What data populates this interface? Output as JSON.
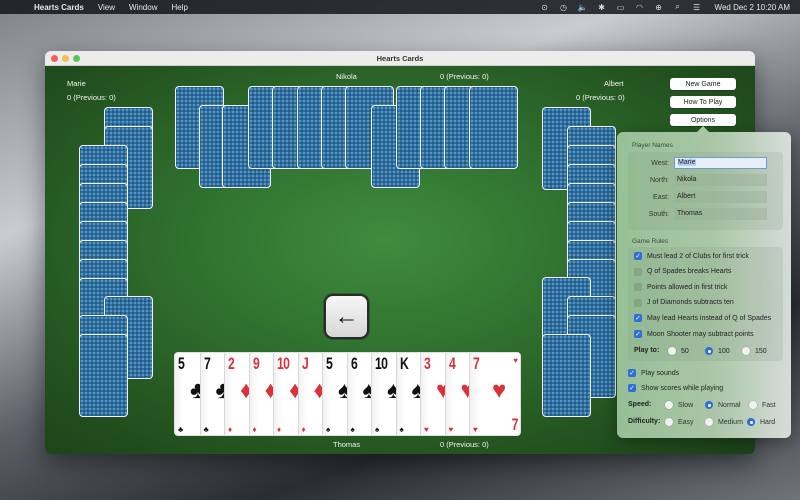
{
  "menubar": {
    "apple": "",
    "items": [
      "Hearts Cards",
      "View",
      "Window",
      "Help"
    ],
    "status_icons": [
      "play-circle-icon",
      "time-machine-icon",
      "volume-icon",
      "bluetooth-icon",
      "battery-icon",
      "wifi-icon",
      "user-icon",
      "search-icon",
      "control-center-icon"
    ],
    "status_glyphs": [
      "⊙",
      "◷",
      "🔈",
      "✱",
      "▭",
      "◠",
      "⊕",
      "⌕",
      "☰"
    ],
    "clock": "Wed Dec 2  10:20 AM"
  },
  "window": {
    "title": "Hearts Cards"
  },
  "players": {
    "west": {
      "name": "Marie",
      "score": "0 (Previous: 0)"
    },
    "north": {
      "name": "Nikola",
      "score": "0 (Previous: 0)"
    },
    "east": {
      "name": "Albert",
      "score": "0 (Previous: 0)"
    },
    "south": {
      "name": "Thomas",
      "score": "0 (Previous: 0)"
    }
  },
  "buttons": {
    "new_game": "New Game",
    "how_to_play": "How To Play",
    "options": "Options",
    "pass_arrow": "←"
  },
  "hand": [
    {
      "rank": "5",
      "suit": "♣",
      "color": "black"
    },
    {
      "rank": "7",
      "suit": "♣",
      "color": "black"
    },
    {
      "rank": "2",
      "suit": "♦",
      "color": "red"
    },
    {
      "rank": "9",
      "suit": "♦",
      "color": "red"
    },
    {
      "rank": "10",
      "suit": "♦",
      "color": "red"
    },
    {
      "rank": "J",
      "suit": "♦",
      "color": "red"
    },
    {
      "rank": "5",
      "suit": "♠",
      "color": "black"
    },
    {
      "rank": "6",
      "suit": "♠",
      "color": "black"
    },
    {
      "rank": "10",
      "suit": "♠",
      "color": "black"
    },
    {
      "rank": "K",
      "suit": "♠",
      "color": "black"
    },
    {
      "rank": "3",
      "suit": "♥",
      "color": "red"
    },
    {
      "rank": "4",
      "suit": "♥",
      "color": "red"
    },
    {
      "rank": "7",
      "suit": "♥",
      "color": "red"
    }
  ],
  "options": {
    "player_names_title": "Player Names",
    "fields": [
      {
        "label": "West:",
        "value": "Marie",
        "focused": true
      },
      {
        "label": "North:",
        "value": "Nikola",
        "focused": false
      },
      {
        "label": "East:",
        "value": "Albert",
        "focused": false
      },
      {
        "label": "South:",
        "value": "Thomas",
        "focused": false
      }
    ],
    "game_rules_title": "Game Rules",
    "rules": [
      {
        "label": "Must lead 2 of Clubs for first trick",
        "checked": true
      },
      {
        "label": "Q of Spades breaks Hearts",
        "checked": false
      },
      {
        "label": "Points allowed in first trick",
        "checked": false
      },
      {
        "label": "J of Diamonds subtracts ten",
        "checked": false
      },
      {
        "label": "May lead Hearts instead of Q of Spades",
        "checked": true
      },
      {
        "label": "Moon Shooter may subtract points",
        "checked": true
      }
    ],
    "play_to": {
      "label": "Play to:",
      "options": [
        "50",
        "100",
        "150"
      ],
      "selected": "100"
    },
    "play_sounds": {
      "label": "Play sounds",
      "checked": true
    },
    "show_scores": {
      "label": "Show scores while playing",
      "checked": true
    },
    "speed": {
      "label": "Speed:",
      "options": [
        "Slow",
        "Normal",
        "Fast"
      ],
      "selected": "Normal"
    },
    "difficulty": {
      "label": "Difficulty:",
      "options": [
        "Easy",
        "Medium",
        "Hard"
      ],
      "selected": "Hard"
    }
  }
}
